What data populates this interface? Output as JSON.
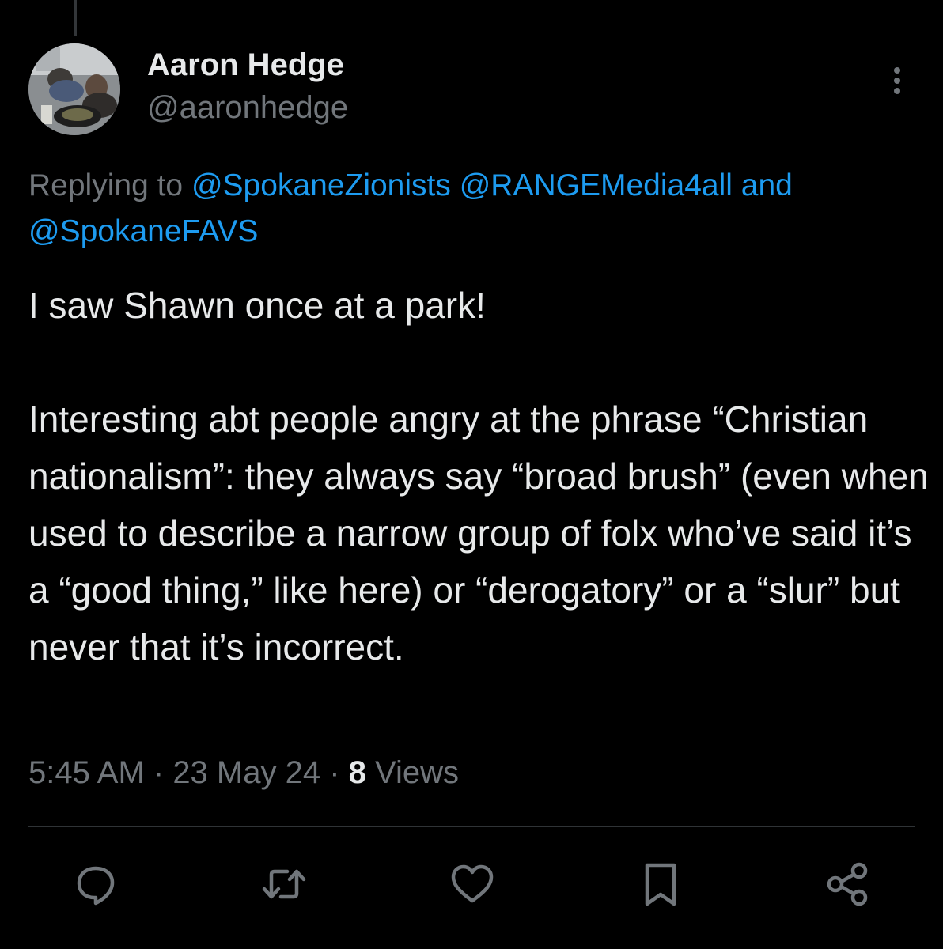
{
  "author": {
    "display_name": "Aaron Hedge",
    "handle": "@aaronhedge"
  },
  "reply_context": {
    "prefix": "Replying to ",
    "mentions": [
      "@SpokaneZionists",
      "@RANGEMedia4all",
      "@SpokaneFAVS"
    ],
    "conjunction": " and"
  },
  "tweet": {
    "text": "I saw Shawn once at a park!\n\nInteresting abt people angry at the phrase “Christian nationalism”: they always say “broad brush” (even when used to describe a narrow group of folx who’ve said it’s a “good thing,” like here) or “derogatory” or a “slur” but never that it’s incorrect."
  },
  "meta": {
    "time": "5:45 AM",
    "separator": " · ",
    "date": "23 May 24",
    "views_count": "8",
    "views_label": " Views"
  },
  "actions": [
    {
      "name": "reply",
      "icon": "reply-icon"
    },
    {
      "name": "repost",
      "icon": "repost-icon"
    },
    {
      "name": "like",
      "icon": "heart-icon"
    },
    {
      "name": "bookmark",
      "icon": "bookmark-icon"
    },
    {
      "name": "share",
      "icon": "share-icon"
    }
  ],
  "colors": {
    "background": "#000000",
    "text": "#e7e9ea",
    "secondary": "#71767b",
    "link": "#1d9bf0",
    "divider": "#2f3336"
  }
}
